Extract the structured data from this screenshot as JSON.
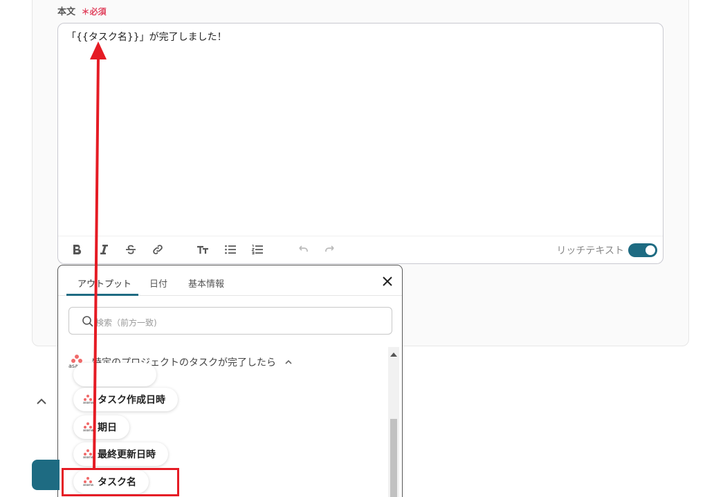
{
  "field": {
    "label": "本文",
    "required_mark": "＊",
    "required_text": "必須",
    "body_text": "「{{タスク名}}」が完了しました！"
  },
  "toolbar": {
    "rich_text_label": "リッチテキスト",
    "rich_text_enabled": true
  },
  "popup": {
    "tabs": [
      "アウトプット",
      "日付",
      "基本情報"
    ],
    "active_tab": "アウトプット",
    "search_placeholder": "検索（前方一致)",
    "group": {
      "title": "特定のプロジェクトのタスクが完了したら",
      "logo_word": "asana",
      "items": [
        {
          "label": "タスク作成日時"
        },
        {
          "label": "期日"
        },
        {
          "label": "最終更新日時"
        },
        {
          "label": "タスク名"
        }
      ]
    }
  },
  "colors": {
    "accent": "#1e6b82",
    "required": "#e0445f",
    "annotation": "#e51b24",
    "asana": "#f06a6a"
  }
}
